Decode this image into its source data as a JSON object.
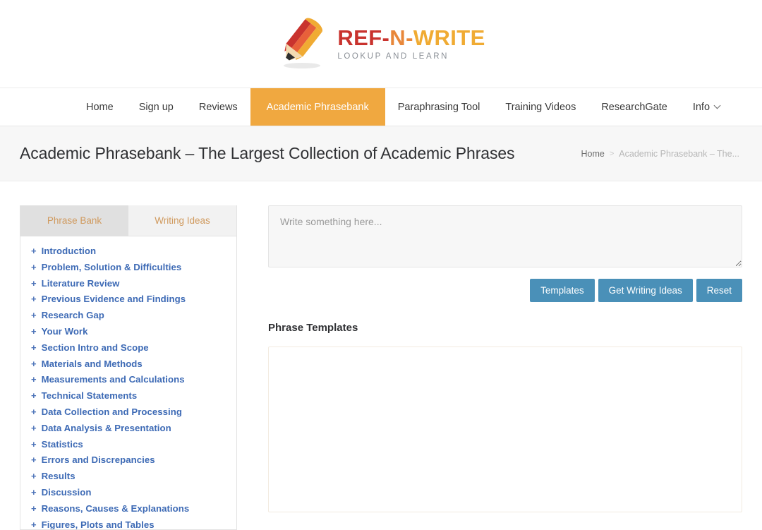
{
  "brand": {
    "logo_icon": "pencil-icon",
    "title_parts": [
      {
        "text": "REF-",
        "color": "#c9332e"
      },
      {
        "text": "N",
        "color": "#e8873a"
      },
      {
        "text": "-",
        "color": "#e8873a"
      },
      {
        "text": "WRITE",
        "color": "#f0ab33"
      }
    ],
    "tagline": "LOOKUP AND LEARN"
  },
  "nav": {
    "items": [
      {
        "label": "Home",
        "active": false
      },
      {
        "label": "Sign up",
        "active": false
      },
      {
        "label": "Reviews",
        "active": false
      },
      {
        "label": "Academic Phrasebank",
        "active": true
      },
      {
        "label": "Paraphrasing Tool",
        "active": false
      },
      {
        "label": "Training Videos",
        "active": false
      },
      {
        "label": "ResearchGate",
        "active": false
      },
      {
        "label": "Info",
        "active": false,
        "has_dropdown": true
      }
    ],
    "active_color": "#f0a840"
  },
  "header": {
    "page_title": "Academic Phrasebank – The Largest Collection of Academic Phrases",
    "breadcrumb": {
      "home": "Home",
      "separator": ">",
      "current": "Academic Phrasebank – The..."
    }
  },
  "sidebar": {
    "tabs": [
      {
        "label": "Phrase Bank",
        "active": true
      },
      {
        "label": "Writing Ideas",
        "active": false
      }
    ],
    "marker": "+",
    "items": [
      {
        "label": "Introduction"
      },
      {
        "label": "Problem, Solution & Difficulties"
      },
      {
        "label": "Literature Review"
      },
      {
        "label": "Previous Evidence and Findings"
      },
      {
        "label": "Research Gap"
      },
      {
        "label": "Your Work"
      },
      {
        "label": "Section Intro and Scope"
      },
      {
        "label": "Materials and Methods"
      },
      {
        "label": "Measurements and Calculations"
      },
      {
        "label": "Technical Statements"
      },
      {
        "label": "Data Collection and Processing"
      },
      {
        "label": "Data Analysis & Presentation"
      },
      {
        "label": "Statistics"
      },
      {
        "label": "Errors and Discrepancies"
      },
      {
        "label": "Results"
      },
      {
        "label": "Discussion"
      },
      {
        "label": "Reasons, Causes & Explanations"
      },
      {
        "label": "Figures, Plots and Tables"
      }
    ],
    "link_color": "#3d6ab5"
  },
  "main": {
    "editor": {
      "placeholder": "Write something here...",
      "value": ""
    },
    "buttons": [
      {
        "label": "Templates"
      },
      {
        "label": "Get Writing Ideas"
      },
      {
        "label": "Reset"
      }
    ],
    "button_color": "#4a90b8",
    "results_heading": "Phrase Templates",
    "results_body": ""
  }
}
